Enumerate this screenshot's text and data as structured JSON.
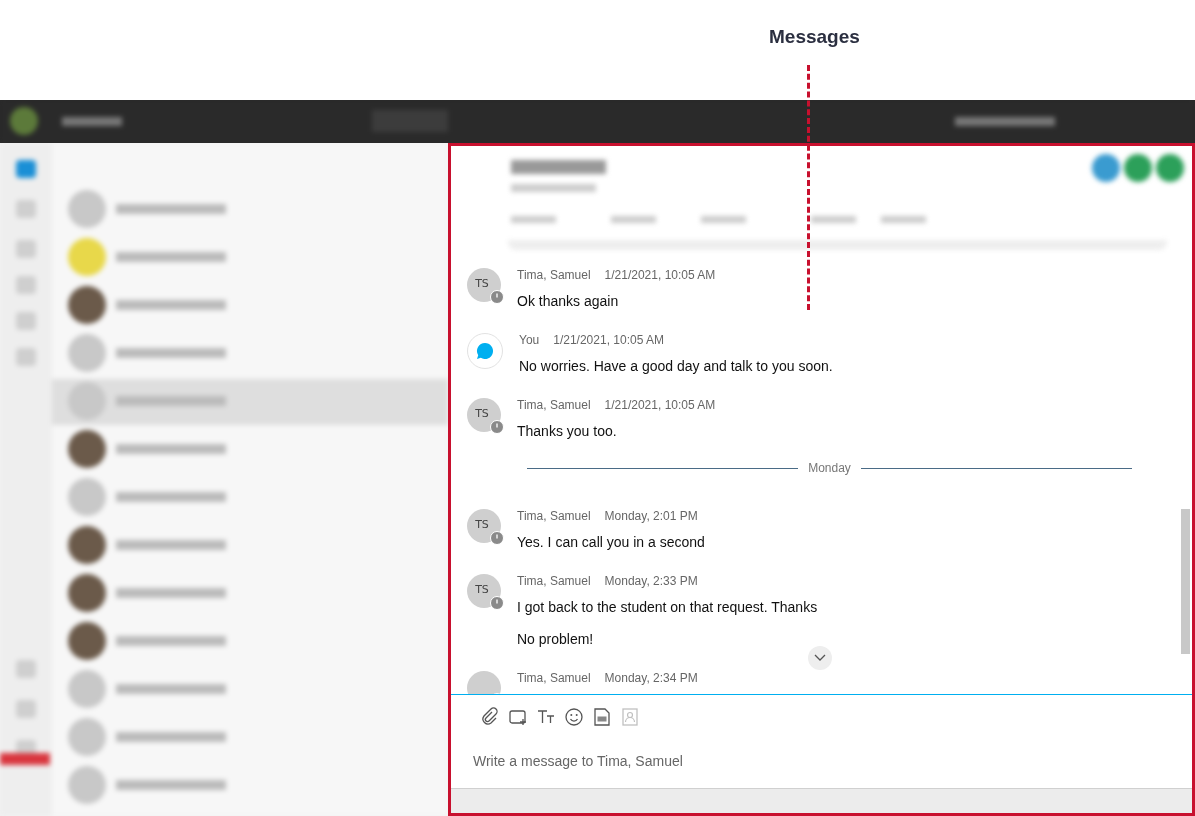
{
  "annotation": {
    "label": "Messages"
  },
  "chat": {
    "items": [
      {
        "kind": "contact",
        "initials": "TS",
        "sender": "Tima, Samuel",
        "time": "1/21/2021, 10:05 AM",
        "lines": [
          "Ok thanks again"
        ]
      },
      {
        "kind": "self",
        "sender": "You",
        "time": "1/21/2021, 10:05 AM",
        "lines": [
          "No worries. Have a good day and talk to you soon."
        ]
      },
      {
        "kind": "contact",
        "initials": "TS",
        "sender": "Tima, Samuel",
        "time": "1/21/2021, 10:05 AM",
        "lines": [
          "Thanks you too."
        ]
      },
      {
        "kind": "divider",
        "label": "Monday"
      },
      {
        "kind": "contact",
        "initials": "TS",
        "sender": "Tima, Samuel",
        "time": "Monday, 2:01 PM",
        "lines": [
          "Yes. I can call you in a second"
        ]
      },
      {
        "kind": "contact",
        "initials": "TS",
        "sender": "Tima, Samuel",
        "time": "Monday, 2:33 PM",
        "lines": [
          "I got back to the student on that request. Thanks",
          "No problem!"
        ]
      },
      {
        "kind": "contact",
        "sender": "Tima, Samuel",
        "time": "Monday, 2:34 PM"
      }
    ],
    "composer": {
      "tools": [
        {
          "kind": "attach",
          "disabled": false
        },
        {
          "kind": "media",
          "disabled": false
        },
        {
          "kind": "format",
          "disabled": false
        },
        {
          "kind": "emoji",
          "disabled": false
        },
        {
          "kind": "gif",
          "disabled": false
        },
        {
          "kind": "contact",
          "disabled": true
        }
      ],
      "placeholder": "Write a message to Tima, Samuel"
    }
  }
}
